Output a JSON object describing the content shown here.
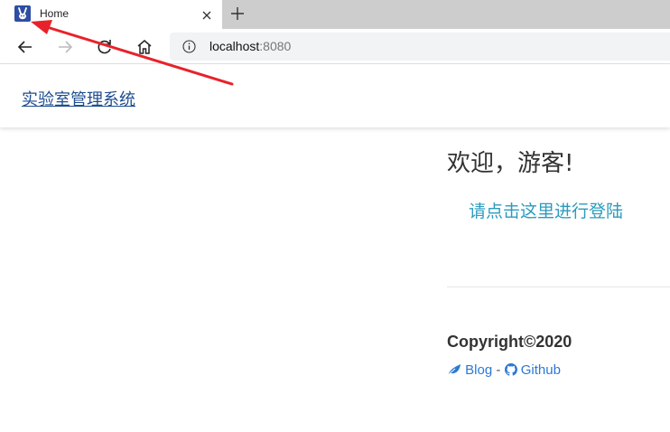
{
  "browser": {
    "tab": {
      "title": "Home",
      "favicon": "rabbit-favicon-icon"
    },
    "address": {
      "host": "localhost",
      "port": ":8080"
    }
  },
  "header": {
    "brand": "实验室管理系统"
  },
  "main": {
    "welcome": "欢迎，游客!",
    "login_link": "请点击这里进行登陆"
  },
  "footer": {
    "copyright": "Copyright©2020",
    "blog_label": "Blog",
    "separator": "-",
    "github_label": "Github"
  },
  "colors": {
    "annotation_arrow": "#e8222a",
    "link": "#2b79d6",
    "login_link": "#2b9bbd",
    "brand_link": "#1f4d8f"
  }
}
